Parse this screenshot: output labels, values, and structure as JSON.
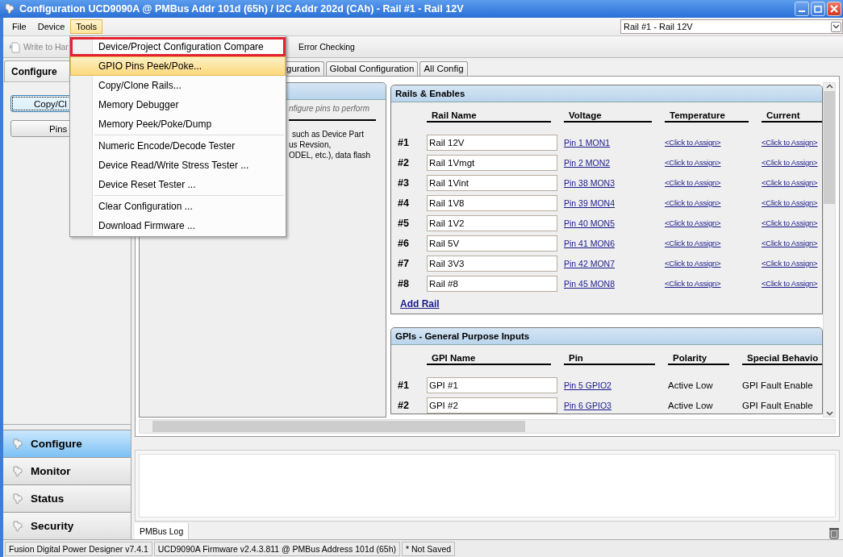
{
  "window": {
    "title": "Configuration UCD9090A @ PMBus Addr 101d (65h) / I2C Addr 202d (CAh)  - Rail #1 - Rail 12V"
  },
  "menu_bar": [
    {
      "label": "File",
      "selected": false
    },
    {
      "label": "Device",
      "selected": false
    },
    {
      "label": "Tools",
      "selected": true
    }
  ],
  "rail_select": {
    "value": "Rail #1 - Rail 12V"
  },
  "toolbar": [
    {
      "label": "Write to Har",
      "kind": "write"
    },
    {
      "label": "Error Checking",
      "kind": "check"
    }
  ],
  "tools_menu": {
    "groups": [
      [
        {
          "label": "Device/Project Configuration Compare",
          "selected": false,
          "outlined": true
        },
        {
          "label": "GPIO Pins Peek/Poke...",
          "selected": true,
          "outlined": false
        },
        {
          "label": "Copy/Clone Rails...",
          "selected": false,
          "outlined": false
        },
        {
          "label": "Memory Debugger",
          "selected": false,
          "outlined": false
        },
        {
          "label": "Memory Peek/Poke/Dump",
          "selected": false,
          "outlined": false
        }
      ],
      [
        {
          "label": "Numeric Encode/Decode Tester",
          "selected": false,
          "outlined": false
        },
        {
          "label": "Device Read/Write Stress Tester ...",
          "selected": false,
          "outlined": false
        },
        {
          "label": "Device Reset Tester ...",
          "selected": false,
          "outlined": false
        }
      ],
      [
        {
          "label": "Clear Configuration ...",
          "selected": false,
          "outlined": false
        },
        {
          "label": "Download Firmware ...",
          "selected": false,
          "outlined": false
        }
      ]
    ]
  },
  "sidebar": {
    "title": "Configure",
    "buttons": [
      {
        "label": "Copy/Cl",
        "focused": true
      },
      {
        "label": "Pins",
        "focused": false
      }
    ],
    "nav": [
      {
        "label": "Configure",
        "selected": true
      },
      {
        "label": "Monitor",
        "selected": false
      },
      {
        "label": "Status",
        "selected": false
      },
      {
        "label": "Security",
        "selected": false
      }
    ]
  },
  "tabs": [
    {
      "label": "guration",
      "selected": false
    },
    {
      "label": "Global Configuration",
      "selected": false
    },
    {
      "label": "All Config",
      "selected": false
    }
  ],
  "info_panel": {
    "hint": "nfigure pins to perform",
    "lines": [
      "such as Device Part",
      "us Revsion,",
      "ODEL, etc.), data flash"
    ]
  },
  "rails": {
    "title": "Rails & Enables",
    "columns": [
      "Rail Name",
      "Voltage",
      "Temperature",
      "Current"
    ],
    "rows": [
      {
        "number": "#1",
        "name": "Rail 12V",
        "voltage": "Pin 1 MON1",
        "temperature": "<Click to Assign>",
        "current": "<Click to Assign>"
      },
      {
        "number": "#2",
        "name": "Rail 1Vmgt",
        "voltage": "Pin 2 MON2",
        "temperature": "<Click to Assign>",
        "current": "<Click to Assign>"
      },
      {
        "number": "#3",
        "name": "Rail 1Vint",
        "voltage": "Pin 38 MON3",
        "temperature": "<Click to Assign>",
        "current": "<Click to Assign>"
      },
      {
        "number": "#4",
        "name": "Rail 1V8",
        "voltage": "Pin 39 MON4",
        "temperature": "<Click to Assign>",
        "current": "<Click to Assign>"
      },
      {
        "number": "#5",
        "name": "Rail 1V2",
        "voltage": "Pin 40 MON5",
        "temperature": "<Click to Assign>",
        "current": "<Click to Assign>"
      },
      {
        "number": "#6",
        "name": "Rail 5V",
        "voltage": "Pin 41 MON6",
        "temperature": "<Click to Assign>",
        "current": "<Click to Assign>"
      },
      {
        "number": "#7",
        "name": "Rail 3V3",
        "voltage": "Pin 42 MON7",
        "temperature": "<Click to Assign>",
        "current": "<Click to Assign>"
      },
      {
        "number": "#8",
        "name": "Rail #8",
        "voltage": "Pin 45 MON8",
        "temperature": "<Click to Assign>",
        "current": "<Click to Assign>"
      }
    ],
    "add_link": "Add Rail"
  },
  "gpis": {
    "title": "GPIs - General Purpose Inputs",
    "columns": [
      "GPI Name",
      "Pin",
      "Polarity",
      "Special Behavio"
    ],
    "rows": [
      {
        "number": "#1",
        "name": "GPI #1",
        "pin": "Pin 5 GPIO2",
        "polarity": "Active Low",
        "special": "GPI Fault Enable"
      },
      {
        "number": "#2",
        "name": "GPI #2",
        "pin": "Pin 6 GPIO3",
        "polarity": "Active Low",
        "special": "GPI Fault Enable"
      }
    ]
  },
  "log": {
    "tab": "PMBus Log"
  },
  "status_bar": [
    "Fusion Digital Power Designer v7.4.1",
    "UCD9090A Firmware v2.4.3.811 @ PMBus Address 101d (65h)",
    "* Not Saved"
  ]
}
